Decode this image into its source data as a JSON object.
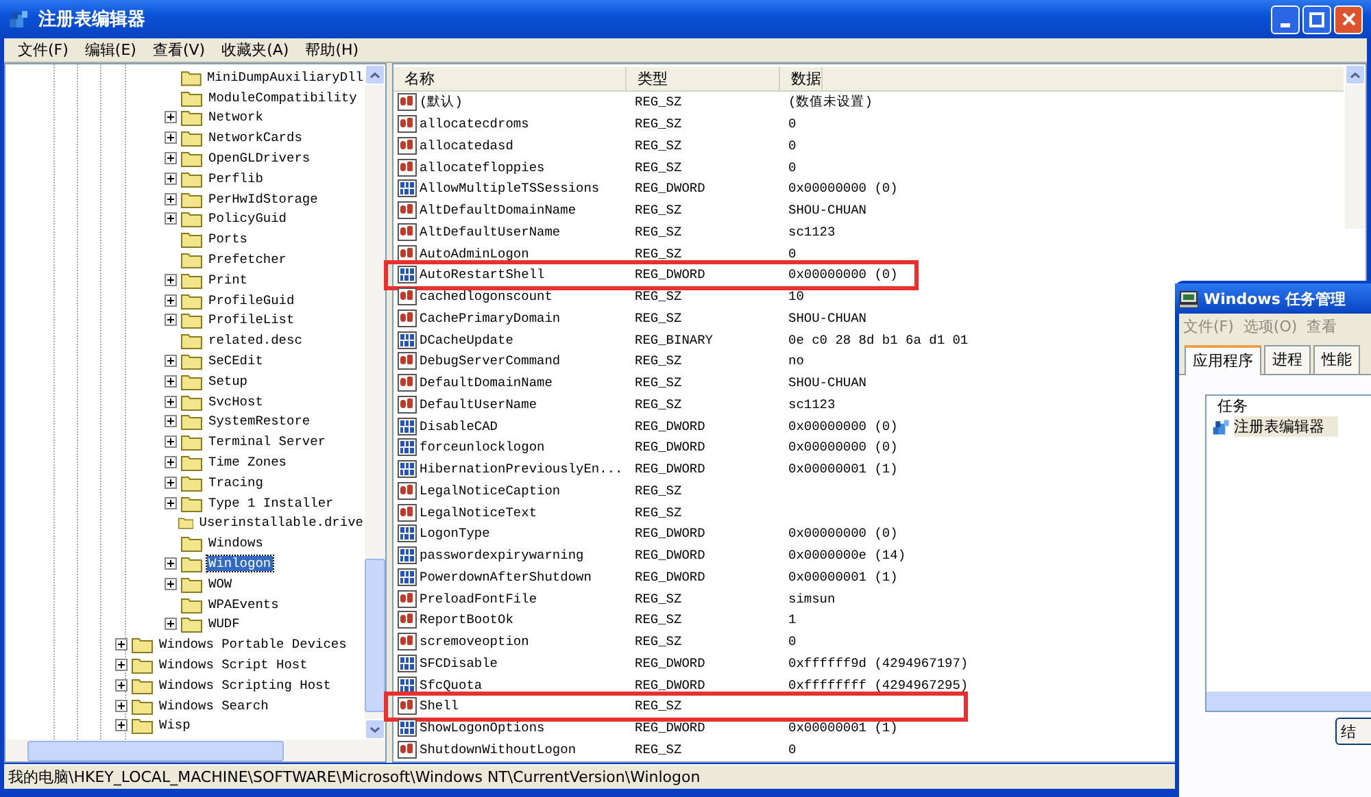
{
  "window": {
    "title": "注册表编辑器"
  },
  "menu": [
    "文件(F)",
    "编辑(E)",
    "查看(V)",
    "收藏夹(A)",
    "帮助(H)"
  ],
  "tree": {
    "subkeys": [
      {
        "label": "MiniDumpAuxiliaryDll",
        "expandable": false,
        "selected": false
      },
      {
        "label": "ModuleCompatibility",
        "expandable": false,
        "selected": false
      },
      {
        "label": "Network",
        "expandable": true,
        "selected": false
      },
      {
        "label": "NetworkCards",
        "expandable": true,
        "selected": false
      },
      {
        "label": "OpenGLDrivers",
        "expandable": true,
        "selected": false
      },
      {
        "label": "Perflib",
        "expandable": true,
        "selected": false
      },
      {
        "label": "PerHwIdStorage",
        "expandable": true,
        "selected": false
      },
      {
        "label": "PolicyGuid",
        "expandable": true,
        "selected": false
      },
      {
        "label": "Ports",
        "expandable": false,
        "selected": false
      },
      {
        "label": "Prefetcher",
        "expandable": false,
        "selected": false
      },
      {
        "label": "Print",
        "expandable": true,
        "selected": false
      },
      {
        "label": "ProfileGuid",
        "expandable": true,
        "selected": false
      },
      {
        "label": "ProfileList",
        "expandable": true,
        "selected": false
      },
      {
        "label": "related.desc",
        "expandable": false,
        "selected": false
      },
      {
        "label": "SeCEdit",
        "expandable": true,
        "selected": false
      },
      {
        "label": "Setup",
        "expandable": true,
        "selected": false
      },
      {
        "label": "SvcHost",
        "expandable": true,
        "selected": false
      },
      {
        "label": "SystemRestore",
        "expandable": true,
        "selected": false
      },
      {
        "label": "Terminal Server",
        "expandable": true,
        "selected": false
      },
      {
        "label": "Time Zones",
        "expandable": true,
        "selected": false
      },
      {
        "label": "Tracing",
        "expandable": true,
        "selected": false
      },
      {
        "label": "Type 1 Installer",
        "expandable": true,
        "selected": false
      },
      {
        "label": "Userinstallable.drive",
        "expandable": false,
        "selected": false
      },
      {
        "label": "Windows",
        "expandable": false,
        "selected": false
      },
      {
        "label": "Winlogon",
        "expandable": true,
        "selected": true
      },
      {
        "label": "WOW",
        "expandable": true,
        "selected": false
      },
      {
        "label": "WPAEvents",
        "expandable": false,
        "selected": false
      },
      {
        "label": "WUDF",
        "expandable": true,
        "selected": false
      }
    ],
    "siblings": [
      {
        "label": "Windows Portable Devices",
        "expandable": true,
        "selected": false
      },
      {
        "label": "Windows Script Host",
        "expandable": true,
        "selected": false
      },
      {
        "label": "Windows Scripting Host",
        "expandable": true,
        "selected": false
      },
      {
        "label": "Windows Search",
        "expandable": true,
        "selected": false
      },
      {
        "label": "Wisp",
        "expandable": true,
        "selected": false
      }
    ]
  },
  "table": {
    "columns": [
      "名称",
      "类型",
      "数据"
    ],
    "rows": [
      {
        "kind": "string",
        "name": "(默认)",
        "type": "REG_SZ",
        "data": "(数值未设置)",
        "highlighted": false
      },
      {
        "kind": "string",
        "name": "allocatecdroms",
        "type": "REG_SZ",
        "data": "0",
        "highlighted": false
      },
      {
        "kind": "string",
        "name": "allocatedasd",
        "type": "REG_SZ",
        "data": "0",
        "highlighted": false
      },
      {
        "kind": "string",
        "name": "allocatefloppies",
        "type": "REG_SZ",
        "data": "0",
        "highlighted": false
      },
      {
        "kind": "binary",
        "name": "AllowMultipleTSSessions",
        "type": "REG_DWORD",
        "data": "0x00000000 (0)",
        "highlighted": false
      },
      {
        "kind": "string",
        "name": "AltDefaultDomainName",
        "type": "REG_SZ",
        "data": "SHOU-CHUAN",
        "highlighted": false
      },
      {
        "kind": "string",
        "name": "AltDefaultUserName",
        "type": "REG_SZ",
        "data": "sc1123",
        "highlighted": false
      },
      {
        "kind": "string",
        "name": "AutoAdminLogon",
        "type": "REG_SZ",
        "data": "0",
        "highlighted": false
      },
      {
        "kind": "binary",
        "name": "AutoRestartShell",
        "type": "REG_DWORD",
        "data": "0x00000000 (0)",
        "highlighted": true
      },
      {
        "kind": "string",
        "name": "cachedlogonscount",
        "type": "REG_SZ",
        "data": "10",
        "highlighted": false
      },
      {
        "kind": "string",
        "name": "CachePrimaryDomain",
        "type": "REG_SZ",
        "data": "SHOU-CHUAN",
        "highlighted": false
      },
      {
        "kind": "binary",
        "name": "DCacheUpdate",
        "type": "REG_BINARY",
        "data": "0e c0 28 8d b1 6a d1 01",
        "highlighted": false
      },
      {
        "kind": "string",
        "name": "DebugServerCommand",
        "type": "REG_SZ",
        "data": "no",
        "highlighted": false
      },
      {
        "kind": "string",
        "name": "DefaultDomainName",
        "type": "REG_SZ",
        "data": "SHOU-CHUAN",
        "highlighted": false
      },
      {
        "kind": "string",
        "name": "DefaultUserName",
        "type": "REG_SZ",
        "data": "sc1123",
        "highlighted": false
      },
      {
        "kind": "binary",
        "name": "DisableCAD",
        "type": "REG_DWORD",
        "data": "0x00000000 (0)",
        "highlighted": false
      },
      {
        "kind": "binary",
        "name": "forceunlocklogon",
        "type": "REG_DWORD",
        "data": "0x00000000 (0)",
        "highlighted": false
      },
      {
        "kind": "binary",
        "name": "HibernationPreviouslyEn...",
        "type": "REG_DWORD",
        "data": "0x00000001 (1)",
        "highlighted": false
      },
      {
        "kind": "string",
        "name": "LegalNoticeCaption",
        "type": "REG_SZ",
        "highlighted": false
      },
      {
        "kind": "string",
        "name": "LegalNoticeText",
        "type": "REG_SZ",
        "highlighted": false
      },
      {
        "kind": "binary",
        "name": "LogonType",
        "type": "REG_DWORD",
        "data": "0x00000000 (0)",
        "highlighted": false
      },
      {
        "kind": "binary",
        "name": "passwordexpirywarning",
        "type": "REG_DWORD",
        "data": "0x0000000e (14)",
        "highlighted": false
      },
      {
        "kind": "binary",
        "name": "PowerdownAfterShutdown",
        "type": "REG_DWORD",
        "data": "0x00000001 (1)",
        "highlighted": false
      },
      {
        "kind": "string",
        "name": "PreloadFontFile",
        "type": "REG_SZ",
        "data": "simsun",
        "highlighted": false
      },
      {
        "kind": "string",
        "name": "ReportBootOk",
        "type": "REG_SZ",
        "data": "1",
        "highlighted": false
      },
      {
        "kind": "string",
        "name": "scremoveoption",
        "type": "REG_SZ",
        "data": "0",
        "highlighted": false
      },
      {
        "kind": "binary",
        "name": "SFCDisable",
        "type": "REG_DWORD",
        "data": "0xffffff9d (4294967197)",
        "highlighted": false
      },
      {
        "kind": "binary",
        "name": "SfcQuota",
        "type": "REG_DWORD",
        "data": "0xffffffff (4294967295)",
        "highlighted": false
      },
      {
        "kind": "string",
        "name": "Shell",
        "type": "REG_SZ",
        "highlighted": true
      },
      {
        "kind": "binary",
        "name": "ShowLogonOptions",
        "type": "REG_DWORD",
        "data": "0x00000001 (1)",
        "highlighted": false
      },
      {
        "kind": "string",
        "name": "ShutdownWithoutLogon",
        "type": "REG_SZ",
        "data": "0",
        "highlighted": false
      }
    ]
  },
  "status_bar": "我的电脑\\HKEY_LOCAL_MACHINE\\SOFTWARE\\Microsoft\\Windows NT\\CurrentVersion\\Winlogon",
  "task_manager": {
    "title": "Windows 任务管理",
    "menu": [
      "文件(F)",
      "选项(O)",
      "查看"
    ],
    "tabs": [
      {
        "label": "应用程序",
        "selected": true
      },
      {
        "label": "进程",
        "selected": false
      },
      {
        "label": "性能",
        "selected": false
      }
    ],
    "columns": [
      "任务"
    ],
    "tasks": [
      "注册表编辑器"
    ],
    "button": "结"
  }
}
